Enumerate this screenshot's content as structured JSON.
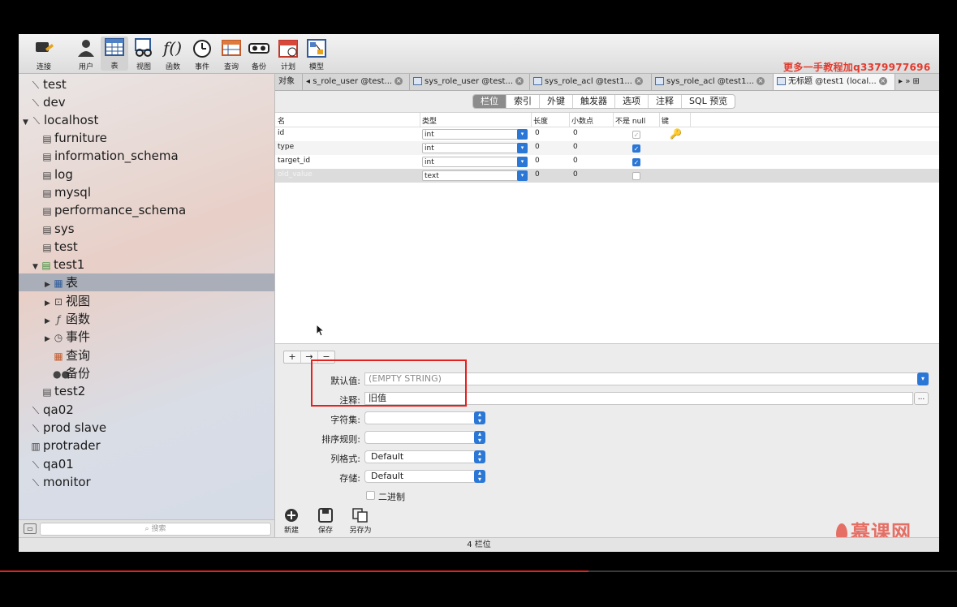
{
  "toolbar": {
    "items": [
      {
        "label": "连接"
      },
      {
        "label": "用户"
      },
      {
        "label": "表"
      },
      {
        "label": "视图"
      },
      {
        "label": "函数"
      },
      {
        "label": "事件"
      },
      {
        "label": "查询"
      },
      {
        "label": "备份"
      },
      {
        "label": "计划"
      },
      {
        "label": "模型"
      }
    ],
    "watermark": "更多一手教程加q3379977696"
  },
  "sidebar": {
    "nodes": [
      {
        "label": "test"
      },
      {
        "label": "dev"
      },
      {
        "label": "localhost"
      },
      {
        "label": "furniture"
      },
      {
        "label": "information_schema"
      },
      {
        "label": "log"
      },
      {
        "label": "mysql"
      },
      {
        "label": "performance_schema"
      },
      {
        "label": "sys"
      },
      {
        "label": "test"
      },
      {
        "label": "test1"
      },
      {
        "label": "表"
      },
      {
        "label": "视图"
      },
      {
        "label": "函数"
      },
      {
        "label": "事件"
      },
      {
        "label": "查询"
      },
      {
        "label": "备份"
      },
      {
        "label": "test2"
      },
      {
        "label": "qa02"
      },
      {
        "label": "prod slave"
      },
      {
        "label": "protrader"
      },
      {
        "label": "qa01"
      },
      {
        "label": "monitor"
      }
    ],
    "search_placeholder": "搜索"
  },
  "tabs": {
    "objects_label": "对象",
    "items": [
      {
        "label": "s_role_user @test..."
      },
      {
        "label": "sys_role_user @test..."
      },
      {
        "label": "sys_role_acl @test1..."
      },
      {
        "label": "sys_role_acl @test1..."
      },
      {
        "label": "无标题 @test1 (local..."
      }
    ]
  },
  "subtabs": [
    "栏位",
    "索引",
    "外键",
    "触发器",
    "选项",
    "注释",
    "SQL 预览"
  ],
  "grid": {
    "headers": [
      "名",
      "类型",
      "长度",
      "小数点",
      "不是 null",
      "键"
    ],
    "rows": [
      {
        "name": "id",
        "type": "int",
        "length": "0",
        "decimals": "0",
        "not_null": true,
        "key": true
      },
      {
        "name": "type",
        "type": "int",
        "length": "0",
        "decimals": "0",
        "not_null": true,
        "key": false
      },
      {
        "name": "target_id",
        "type": "int",
        "length": "0",
        "decimals": "0",
        "not_null": true,
        "key": false
      },
      {
        "name": "old_value",
        "type": "text",
        "length": "0",
        "decimals": "0",
        "not_null": false,
        "key": false
      }
    ]
  },
  "panel": {
    "add": "+",
    "insert": "→",
    "remove": "−",
    "default_label": "默认值:",
    "default_value": "(EMPTY STRING)",
    "comment_label": "注释:",
    "comment_value": "旧值",
    "charset_label": "字符集:",
    "collation_label": "排序规则:",
    "format_label": "列格式:",
    "format_value": "Default",
    "storage_label": "存储:",
    "storage_value": "Default",
    "binary_label": "二进制",
    "more": "..."
  },
  "footer": {
    "new": "新建",
    "save": "保存",
    "save_as": "另存为",
    "status": "4 栏位"
  },
  "logo_text": "慕课网",
  "video_progress": 0.615
}
